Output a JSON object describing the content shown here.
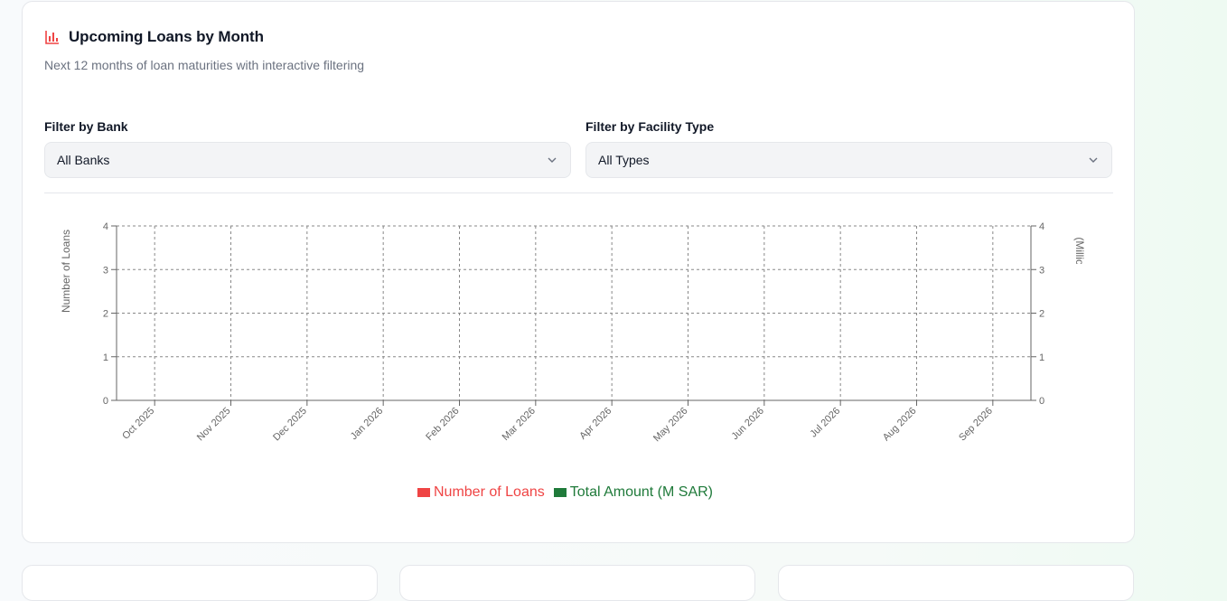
{
  "card": {
    "title": "Upcoming Loans by Month",
    "subtitle": "Next 12 months of loan maturities with interactive filtering",
    "title_icon": "bar-chart-icon"
  },
  "filters": {
    "bank": {
      "label": "Filter by Bank",
      "value": "All Banks"
    },
    "type": {
      "label": "Filter by Facility Type",
      "value": "All Types"
    }
  },
  "colors": {
    "loans": "#ef4444",
    "amount": "#1f7a3a",
    "accent": "#ef4444"
  },
  "chart_data": {
    "type": "bar",
    "categories": [
      "Oct 2025",
      "Nov 2025",
      "Dec 2025",
      "Jan 2026",
      "Feb 2026",
      "Mar 2026",
      "Apr 2026",
      "May 2026",
      "Jun 2026",
      "Jul 2026",
      "Aug 2026",
      "Sep 2026"
    ],
    "series": [
      {
        "name": "Number of Loans",
        "axis": "left",
        "values": [
          0,
          0,
          0,
          0,
          0,
          0,
          0,
          0,
          0,
          0,
          0,
          0
        ]
      },
      {
        "name": "Total Amount (M SAR)",
        "axis": "right",
        "values": [
          0,
          0,
          0,
          0,
          0,
          0,
          0,
          0,
          0,
          0,
          0,
          0
        ]
      }
    ],
    "ylabel": "Number of Loans",
    "y2label": "Amount (Millions SAR)",
    "ylim": [
      0,
      4
    ],
    "y2lim": [
      0,
      4
    ],
    "yticks": [
      "0",
      "1",
      "2",
      "3",
      "4"
    ],
    "grid": true,
    "legend": "bottom"
  }
}
